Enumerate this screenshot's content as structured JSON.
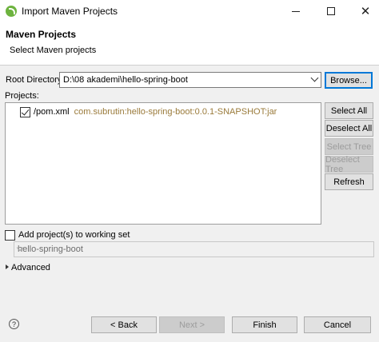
{
  "window": {
    "title": "Import Maven Projects"
  },
  "header": {
    "title": "Maven Projects",
    "subtitle": "Select Maven projects"
  },
  "root": {
    "label": "Root Directory:",
    "value": "D:\\08 akademi\\hello-spring-boot",
    "browse": "Browse..."
  },
  "projects": {
    "label": "Projects:",
    "items": [
      {
        "name": "/pom.xml",
        "artifact": "com.subrutin:hello-spring-boot:0.0.1-SNAPSHOT:jar",
        "checked": true
      }
    ]
  },
  "side_buttons": {
    "select_all": "Select All",
    "deselect_all": "Deselect All",
    "select_tree": "Select Tree",
    "deselect_tree": "Deselect Tree",
    "refresh": "Refresh"
  },
  "working_set": {
    "label": "Add project(s) to working set",
    "value": "hello-spring-boot",
    "checked": false
  },
  "advanced": {
    "label": "Advanced"
  },
  "footer": {
    "help": "?",
    "back": "< Back",
    "next": "Next >",
    "finish": "Finish",
    "cancel": "Cancel"
  },
  "colors": {
    "artifact": "#9a7a3a",
    "focus": "#0078d7",
    "spring": "#6db33f"
  }
}
